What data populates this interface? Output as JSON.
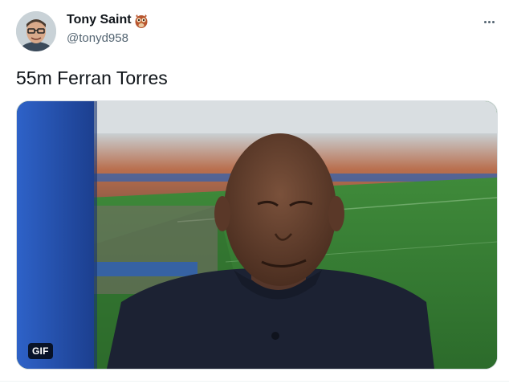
{
  "user": {
    "display_name": "Tony Saint",
    "handle": "@tonyd958",
    "badge_icon": "owl-icon"
  },
  "tweet": {
    "text": "55m Ferran Torres"
  },
  "media": {
    "type": "gif",
    "badge_label": "GIF"
  },
  "actions": {
    "more_icon": "more-horizontal-icon"
  },
  "colors": {
    "text_primary": "#0f1419",
    "text_secondary": "#536471",
    "border": "#d8dee2"
  }
}
